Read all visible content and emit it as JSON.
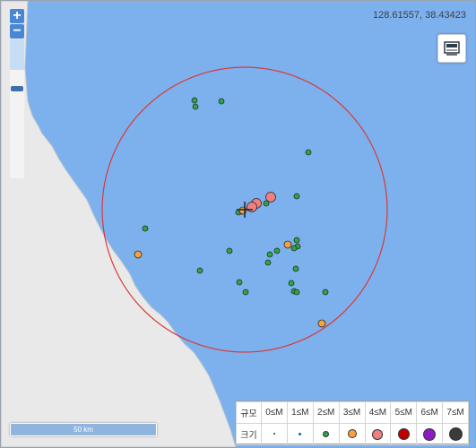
{
  "map": {
    "coord_readout": "128.61557, 38.43423",
    "scale_label": "50 km",
    "sea_color": "#7db1ee",
    "land_color": "#e9e9e9",
    "circle_color": "#d73a3a"
  },
  "controls": {
    "zoom_in_label": "+",
    "zoom_out_label": "−",
    "layer_button_icon": "layers-icon"
  },
  "legend": {
    "row_labels": [
      "규모",
      "크기"
    ],
    "classes": [
      {
        "label": "0≤M",
        "color": "#333333"
      },
      {
        "label": "1≤M",
        "color": "#1f5aa6"
      },
      {
        "label": "2≤M",
        "color": "#28a745"
      },
      {
        "label": "3≤M",
        "color": "#f5a23c"
      },
      {
        "label": "4≤M",
        "color": "#f08080"
      },
      {
        "label": "5≤M",
        "color": "#c00000"
      },
      {
        "label": "6≤M",
        "color": "#8b1cc4"
      },
      {
        "label": "7≤M",
        "color": "#3a3a3a"
      }
    ]
  },
  "epicenter_marker": "crosshair-icon",
  "quakes": [
    {
      "magnitude_class": "2≤M"
    },
    {
      "magnitude_class": "2≤M"
    },
    {
      "magnitude_class": "2≤M"
    },
    {
      "magnitude_class": "2≤M"
    },
    {
      "magnitude_class": "2≤M"
    },
    {
      "magnitude_class": "2≤M"
    },
    {
      "magnitude_class": "2≤M"
    },
    {
      "magnitude_class": "2≤M"
    },
    {
      "magnitude_class": "2≤M"
    },
    {
      "magnitude_class": "2≤M"
    },
    {
      "magnitude_class": "2≤M"
    },
    {
      "magnitude_class": "2≤M"
    },
    {
      "magnitude_class": "2≤M"
    },
    {
      "magnitude_class": "2≤M"
    },
    {
      "magnitude_class": "2≤M"
    },
    {
      "magnitude_class": "2≤M"
    },
    {
      "magnitude_class": "2≤M"
    },
    {
      "magnitude_class": "2≤M"
    },
    {
      "magnitude_class": "2≤M"
    },
    {
      "magnitude_class": "2≤M"
    },
    {
      "magnitude_class": "2≤M"
    },
    {
      "magnitude_class": "2≤M"
    },
    {
      "magnitude_class": "2≤M"
    },
    {
      "magnitude_class": "2≤M"
    },
    {
      "magnitude_class": "2≤M"
    },
    {
      "magnitude_class": "3≤M"
    },
    {
      "magnitude_class": "3≤M"
    },
    {
      "magnitude_class": "3≤M"
    },
    {
      "magnitude_class": "3≤M"
    },
    {
      "magnitude_class": "4≤M"
    },
    {
      "magnitude_class": "4≤M"
    },
    {
      "magnitude_class": "4≤M"
    }
  ]
}
